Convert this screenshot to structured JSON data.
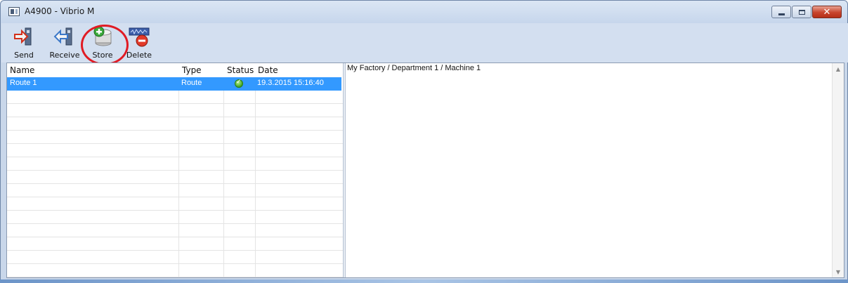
{
  "window": {
    "title": "A4900 - Vibrio M",
    "controls": [
      "minimize-icon",
      "maximize-icon",
      "close-icon"
    ]
  },
  "toolbar": {
    "items": [
      {
        "label": "Send",
        "icon": "send-arrow-icon"
      },
      {
        "label": "Receive",
        "icon": "receive-arrow-icon"
      },
      {
        "label": "Store",
        "icon": "store-add-icon"
      },
      {
        "label": "Delete",
        "icon": "delete-icon"
      }
    ]
  },
  "table": {
    "columns": [
      "Name",
      "Type",
      "Status",
      "Date"
    ],
    "rows": [
      {
        "name": "Route 1",
        "type": "Route",
        "status": "ok",
        "date": "19.3.2015 15:16:40"
      }
    ]
  },
  "detail": {
    "path": "My Factory / Department 1 / Machine 1"
  },
  "colors": {
    "selection": "#3399ff",
    "highlight_ring": "#e01b24",
    "status_ok": "#3ea422"
  }
}
